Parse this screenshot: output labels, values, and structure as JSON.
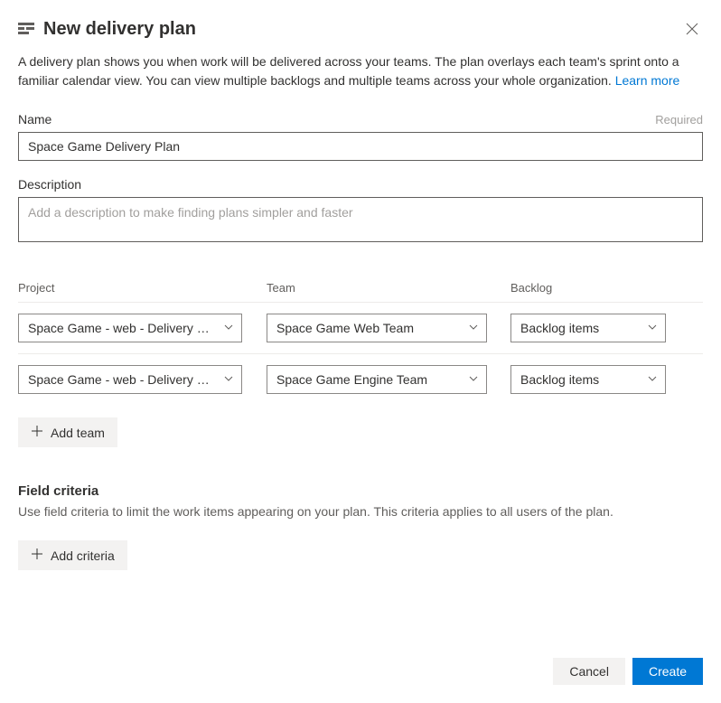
{
  "header": {
    "title": "New delivery plan"
  },
  "intro": {
    "text": "A delivery plan shows you when work will be delivered across your teams. The plan overlays each team's sprint onto a familiar calendar view. You can view multiple backlogs and multiple teams across your whole organization. ",
    "link": "Learn more"
  },
  "fields": {
    "name": {
      "label": "Name",
      "required": "Required",
      "value": "Space Game Delivery Plan"
    },
    "description": {
      "label": "Description",
      "placeholder": "Add a description to make finding plans simpler and faster"
    }
  },
  "columns": {
    "project": "Project",
    "team": "Team",
    "backlog": "Backlog"
  },
  "rows": [
    {
      "project": "Space Game - web - Delivery pl...",
      "team": "Space Game Web Team",
      "backlog": "Backlog items"
    },
    {
      "project": "Space Game - web - Delivery pl...",
      "team": "Space Game Engine Team",
      "backlog": "Backlog items"
    }
  ],
  "addTeam": "Add team",
  "criteria": {
    "title": "Field criteria",
    "desc": "Use field criteria to limit the work items appearing on your plan. This criteria applies to all users of the plan.",
    "addButton": "Add criteria"
  },
  "footer": {
    "cancel": "Cancel",
    "create": "Create"
  }
}
